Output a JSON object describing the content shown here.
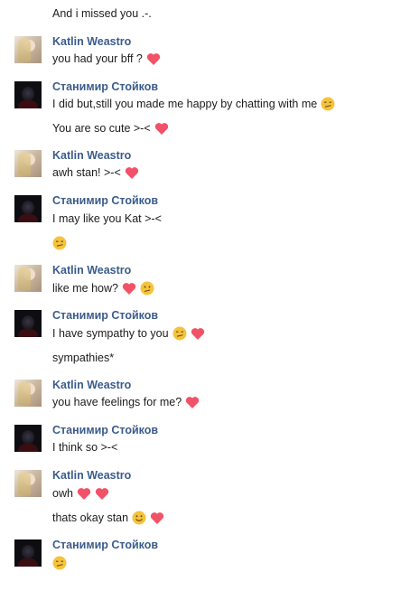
{
  "names": {
    "katlin": "Katlin Weastro",
    "stanimir": "Станимир Стойков"
  },
  "messages": {
    "m0": "And i missed you .-.",
    "m1": "you had your bff ?",
    "m2": "I did but,still you made me happy by chatting with me",
    "m3": "You are so cute >-<",
    "m4": "awh stan! >-<",
    "m5": "I may like you Kat >-<",
    "m6": "like me how?",
    "m7": "I have sympathy to you",
    "m8": "sympathies*",
    "m9": "you have feelings for me?",
    "m10": "I think so >-<",
    "m11": "owh",
    "m12": "thats okay stan"
  },
  "colors": {
    "name": "#3b5c8c",
    "heart": "#f25268",
    "emoji": "#f5c33b"
  },
  "icons": [
    "heart-icon",
    "smirk-emoji-icon",
    "confused-emoji-icon",
    "smile-emoji-icon"
  ]
}
